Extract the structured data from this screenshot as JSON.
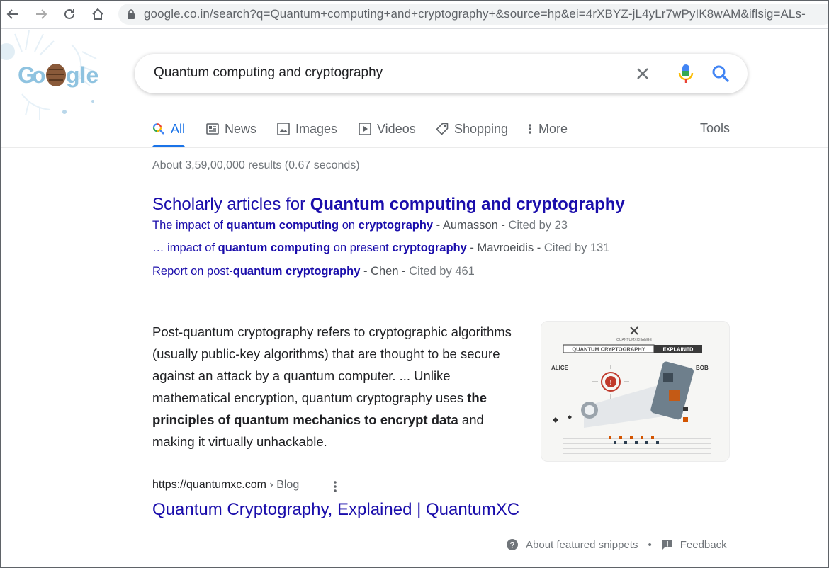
{
  "browser": {
    "url": "google.co.in/search?q=Quantum+computing+and+cryptography+&source=hp&ei=4rXBYZ-jL4yLr7wPyIK8wAM&iflsig=ALs-"
  },
  "search": {
    "query": "Quantum computing and cryptography"
  },
  "tabs": [
    {
      "label": "All",
      "icon": "search-multicolor-icon"
    },
    {
      "label": "News",
      "icon": "news-icon"
    },
    {
      "label": "Images",
      "icon": "image-icon"
    },
    {
      "label": "Videos",
      "icon": "video-icon"
    },
    {
      "label": "Shopping",
      "icon": "tag-icon"
    },
    {
      "label": "More",
      "icon": "vertical-dots-icon"
    }
  ],
  "tools_label": "Tools",
  "result_stats": "About 3,59,00,000 results (0.67 seconds)",
  "scholarly": {
    "title_prefix": "Scholarly articles for ",
    "title_query": "Quantum computing and cryptography",
    "items": [
      {
        "parts": [
          "The impact of ",
          "quantum computing",
          " on ",
          "cryptography"
        ],
        "author": " - Aumasson - ",
        "cited": "Cited by 23"
      },
      {
        "parts": [
          "… impact of ",
          "quantum computing",
          " on present ",
          "cryptography"
        ],
        "author": " - Mavroeidis - ",
        "cited": "Cited by 131"
      },
      {
        "parts": [
          "Report on post-",
          "quantum cryptography",
          "",
          ""
        ],
        "author": " - Chen - ",
        "cited": "Cited by 461"
      }
    ]
  },
  "snippet": {
    "text_plain": "Post-quantum cryptography refers to cryptographic algorithms (usually public-key algorithms) that are thought to be secure against an attack by a quantum computer. ... Unlike mathematical encryption, quantum cryptography uses ",
    "text_bold": "the principles of quantum mechanics to encrypt data",
    "text_end": " and making it virtually unhackable.",
    "image": {
      "brand": "QUANTUMXCHANGE",
      "banner_left": "QUANTUM CRYPTOGRAPHY",
      "banner_right": "EXPLAINED",
      "alice": "ALICE",
      "bob": "BOB"
    }
  },
  "result": {
    "site": "https://quantumxc.com",
    "crumb": " › Blog",
    "title": "Quantum Cryptography, Explained | QuantumXC"
  },
  "footer": {
    "about_label": "About featured snippets",
    "bullet": "•",
    "feedback_label": "Feedback"
  },
  "colors": {
    "link": "#1a0dab",
    "accent": "#1a73e8",
    "muted": "#70757a"
  }
}
